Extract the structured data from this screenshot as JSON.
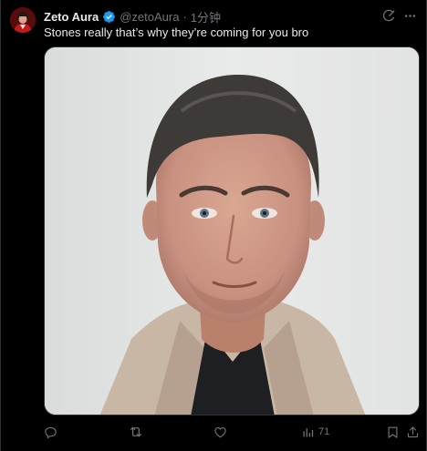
{
  "tweet": {
    "author_name": "Zeto Aura",
    "handle": "@zetoAura",
    "separator": "·",
    "time": "1分钟",
    "text": "Stones really that’s why they’re coming for you bro"
  },
  "actions": {
    "views_count": "71"
  },
  "colors": {
    "background": "#000000",
    "text_primary": "#e7e9ea",
    "text_secondary": "#71767b",
    "verified_blue": "#1d9bf0",
    "border": "#2f3336"
  },
  "icons": {
    "verified": "verified-badge-icon",
    "grok": "grok-icon",
    "more": "more-icon",
    "reply": "reply-icon",
    "repost": "repost-icon",
    "like": "like-icon",
    "views": "views-icon",
    "bookmark": "bookmark-icon",
    "share": "share-icon"
  }
}
